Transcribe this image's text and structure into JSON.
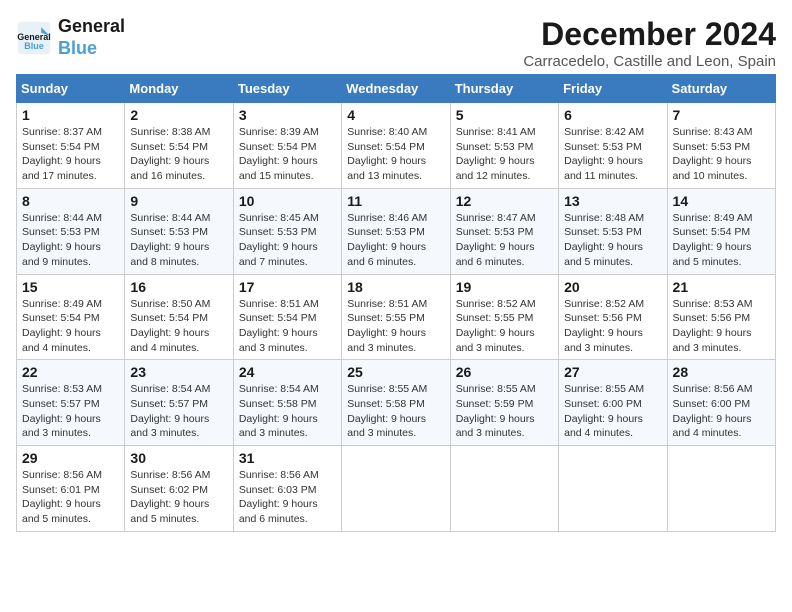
{
  "logo": {
    "line1": "General",
    "line2": "Blue"
  },
  "title": "December 2024",
  "location": "Carracedelo, Castille and Leon, Spain",
  "weekdays": [
    "Sunday",
    "Monday",
    "Tuesday",
    "Wednesday",
    "Thursday",
    "Friday",
    "Saturday"
  ],
  "weeks": [
    [
      {
        "day": "1",
        "info": "Sunrise: 8:37 AM\nSunset: 5:54 PM\nDaylight: 9 hours and 17 minutes."
      },
      {
        "day": "2",
        "info": "Sunrise: 8:38 AM\nSunset: 5:54 PM\nDaylight: 9 hours and 16 minutes."
      },
      {
        "day": "3",
        "info": "Sunrise: 8:39 AM\nSunset: 5:54 PM\nDaylight: 9 hours and 15 minutes."
      },
      {
        "day": "4",
        "info": "Sunrise: 8:40 AM\nSunset: 5:54 PM\nDaylight: 9 hours and 13 minutes."
      },
      {
        "day": "5",
        "info": "Sunrise: 8:41 AM\nSunset: 5:53 PM\nDaylight: 9 hours and 12 minutes."
      },
      {
        "day": "6",
        "info": "Sunrise: 8:42 AM\nSunset: 5:53 PM\nDaylight: 9 hours and 11 minutes."
      },
      {
        "day": "7",
        "info": "Sunrise: 8:43 AM\nSunset: 5:53 PM\nDaylight: 9 hours and 10 minutes."
      }
    ],
    [
      {
        "day": "8",
        "info": "Sunrise: 8:44 AM\nSunset: 5:53 PM\nDaylight: 9 hours and 9 minutes."
      },
      {
        "day": "9",
        "info": "Sunrise: 8:44 AM\nSunset: 5:53 PM\nDaylight: 9 hours and 8 minutes."
      },
      {
        "day": "10",
        "info": "Sunrise: 8:45 AM\nSunset: 5:53 PM\nDaylight: 9 hours and 7 minutes."
      },
      {
        "day": "11",
        "info": "Sunrise: 8:46 AM\nSunset: 5:53 PM\nDaylight: 9 hours and 6 minutes."
      },
      {
        "day": "12",
        "info": "Sunrise: 8:47 AM\nSunset: 5:53 PM\nDaylight: 9 hours and 6 minutes."
      },
      {
        "day": "13",
        "info": "Sunrise: 8:48 AM\nSunset: 5:53 PM\nDaylight: 9 hours and 5 minutes."
      },
      {
        "day": "14",
        "info": "Sunrise: 8:49 AM\nSunset: 5:54 PM\nDaylight: 9 hours and 5 minutes."
      }
    ],
    [
      {
        "day": "15",
        "info": "Sunrise: 8:49 AM\nSunset: 5:54 PM\nDaylight: 9 hours and 4 minutes."
      },
      {
        "day": "16",
        "info": "Sunrise: 8:50 AM\nSunset: 5:54 PM\nDaylight: 9 hours and 4 minutes."
      },
      {
        "day": "17",
        "info": "Sunrise: 8:51 AM\nSunset: 5:54 PM\nDaylight: 9 hours and 3 minutes."
      },
      {
        "day": "18",
        "info": "Sunrise: 8:51 AM\nSunset: 5:55 PM\nDaylight: 9 hours and 3 minutes."
      },
      {
        "day": "19",
        "info": "Sunrise: 8:52 AM\nSunset: 5:55 PM\nDaylight: 9 hours and 3 minutes."
      },
      {
        "day": "20",
        "info": "Sunrise: 8:52 AM\nSunset: 5:56 PM\nDaylight: 9 hours and 3 minutes."
      },
      {
        "day": "21",
        "info": "Sunrise: 8:53 AM\nSunset: 5:56 PM\nDaylight: 9 hours and 3 minutes."
      }
    ],
    [
      {
        "day": "22",
        "info": "Sunrise: 8:53 AM\nSunset: 5:57 PM\nDaylight: 9 hours and 3 minutes."
      },
      {
        "day": "23",
        "info": "Sunrise: 8:54 AM\nSunset: 5:57 PM\nDaylight: 9 hours and 3 minutes."
      },
      {
        "day": "24",
        "info": "Sunrise: 8:54 AM\nSunset: 5:58 PM\nDaylight: 9 hours and 3 minutes."
      },
      {
        "day": "25",
        "info": "Sunrise: 8:55 AM\nSunset: 5:58 PM\nDaylight: 9 hours and 3 minutes."
      },
      {
        "day": "26",
        "info": "Sunrise: 8:55 AM\nSunset: 5:59 PM\nDaylight: 9 hours and 3 minutes."
      },
      {
        "day": "27",
        "info": "Sunrise: 8:55 AM\nSunset: 6:00 PM\nDaylight: 9 hours and 4 minutes."
      },
      {
        "day": "28",
        "info": "Sunrise: 8:56 AM\nSunset: 6:00 PM\nDaylight: 9 hours and 4 minutes."
      }
    ],
    [
      {
        "day": "29",
        "info": "Sunrise: 8:56 AM\nSunset: 6:01 PM\nDaylight: 9 hours and 5 minutes."
      },
      {
        "day": "30",
        "info": "Sunrise: 8:56 AM\nSunset: 6:02 PM\nDaylight: 9 hours and 5 minutes."
      },
      {
        "day": "31",
        "info": "Sunrise: 8:56 AM\nSunset: 6:03 PM\nDaylight: 9 hours and 6 minutes."
      },
      {
        "day": "",
        "info": ""
      },
      {
        "day": "",
        "info": ""
      },
      {
        "day": "",
        "info": ""
      },
      {
        "day": "",
        "info": ""
      }
    ]
  ]
}
